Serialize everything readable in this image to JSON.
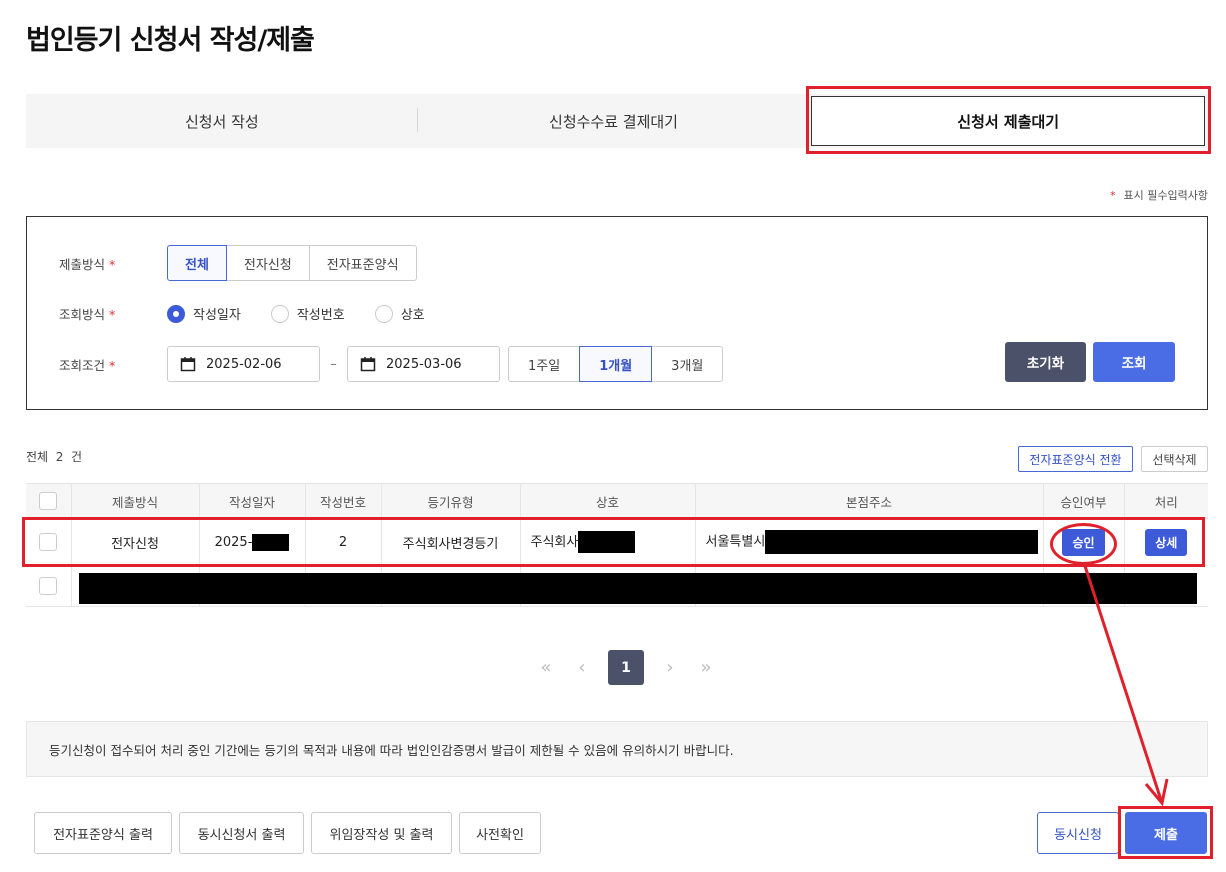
{
  "page": {
    "title": "법인등기 신청서 작성/제출"
  },
  "tabs": [
    {
      "label": "신청서 작성"
    },
    {
      "label": "신청수수료 결제대기"
    },
    {
      "label": "신청서 제출대기"
    }
  ],
  "required_note": {
    "star": "*",
    "text": "표시 필수입력사항"
  },
  "search": {
    "submit_method": {
      "label": "제출방식",
      "star": "*",
      "options": [
        "전체",
        "전자신청",
        "전자표준양식"
      ],
      "selected": "전체"
    },
    "query_method": {
      "label": "조회방식",
      "star": "*",
      "options": [
        "작성일자",
        "작성번호",
        "상호"
      ],
      "selected": "작성일자"
    },
    "query_cond": {
      "label": "조회조건",
      "star": "*",
      "from": "2025-02-06",
      "sep": "–",
      "to": "2025-03-06",
      "periods": [
        "1주일",
        "1개월",
        "3개월"
      ],
      "selected": "1개월"
    },
    "reset_label": "초기화",
    "search_label": "조회"
  },
  "list": {
    "total_label": "전체",
    "total_count": "2",
    "total_unit": "건",
    "convert_label": "전자표준양식 전환",
    "delete_label": "선택삭제",
    "columns": [
      "제출방식",
      "작성일자",
      "작성번호",
      "등기유형",
      "상호",
      "본점주소",
      "승인여부",
      "처리"
    ],
    "rows": [
      {
        "method": "전자신청",
        "date": "2025-",
        "number": "2",
        "type": "주식회사변경등기",
        "company": "주식회사",
        "address": "서울특별시",
        "approval": "승인",
        "action": "상세"
      }
    ]
  },
  "pagination": {
    "first": "«",
    "prev": "‹",
    "current": "1",
    "next": "›",
    "last": "»"
  },
  "notice": "등기신청이 접수되어 처리 중인 기간에는 등기의 목적과 내용에 따라 법인인감증명서 발급이 제한될 수 있음에 유의하시기 바랍니다.",
  "bottom_buttons": {
    "print_std": "전자표준양식 출력",
    "print_simul": "동시신청서 출력",
    "proxy": "위임장작성 및 출력",
    "precheck": "사전확인",
    "simultaneous": "동시신청",
    "submit": "제출"
  },
  "colors": {
    "accent": "#4a6de5",
    "dark": "#4a5168",
    "highlight": "#e0202a"
  }
}
